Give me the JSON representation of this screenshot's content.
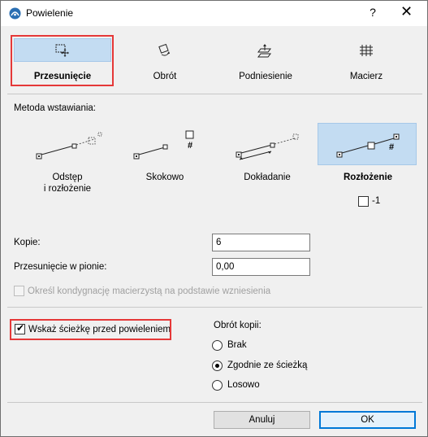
{
  "window": {
    "title": "Powielenie",
    "help_label": "?",
    "close_label": "✕"
  },
  "modes": {
    "move": "Przesunięcie",
    "rotate": "Obrót",
    "elevate": "Podniesienie",
    "matrix": "Macierz"
  },
  "method": {
    "label": "Metoda wstawiania:",
    "spacing_line1": "Odstęp",
    "spacing_line2": "i rozłożenie",
    "increment": "Skokowo",
    "append": "Dokładanie",
    "distribution": "Rozłożenie",
    "hash": "#",
    "minus_one_label": "-1"
  },
  "fields": {
    "copies_label": "Kopie:",
    "copies_value": "6",
    "vertical_label": "Przesunięcie w pionie:",
    "vertical_value": "0,00",
    "storey_label": "Określ kondygnację macierzystą na podstawie wzniesienia"
  },
  "path": {
    "show_path_label": "Wskaż ścieżkę przed powieleniem"
  },
  "rotation": {
    "label": "Obrót kopii:",
    "none": "Brak",
    "along_path": "Zgodnie ze ścieżką",
    "random": "Losowo"
  },
  "buttons": {
    "cancel": "Anuluj",
    "ok": "OK"
  },
  "colors": {
    "selection": "#c3dcf2",
    "highlight_red": "#e53838",
    "default_button_border": "#0078d7"
  }
}
